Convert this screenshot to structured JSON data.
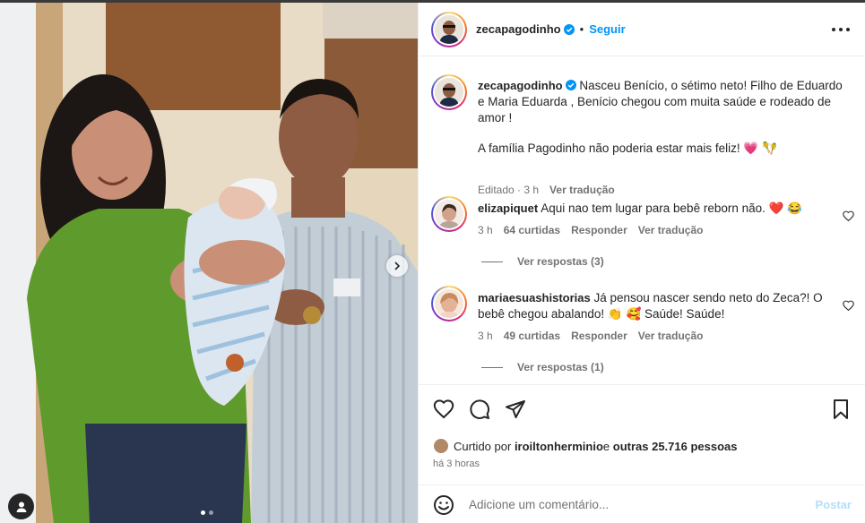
{
  "post": {
    "username": "zecapagodinho",
    "follow_label": "Seguir",
    "caption_line1": "Nasceu Benício, o sétimo neto! Filho de Eduardo",
    "caption_line2": "e Maria Eduarda , Benício chegou com muita saúde e rodeado de",
    "caption_line3": "amor !",
    "caption_line4": "A família Pagodinho não poderia estar mais feliz! 💗 🪇",
    "caption_edited": "Editado · 3 h",
    "caption_translate": "Ver tradução"
  },
  "comments": [
    {
      "username": "elizapiquet",
      "text": "Aqui nao tem lugar para bebê reborn não. ❤️ 😂",
      "time": "3 h",
      "likes": "64 curtidas",
      "reply": "Responder",
      "translate": "Ver tradução",
      "replies": "Ver respostas (3)"
    },
    {
      "username": "mariaesuashistorias",
      "text_line1": "Já pensou nascer sendo neto do Zeca?! O",
      "text_line2": "bebê chegou abalando! 👏 🥰 Saúde! Saúde!",
      "time": "3 h",
      "likes": "49 curtidas",
      "reply": "Responder",
      "translate": "Ver tradução",
      "replies": "Ver respostas (1)"
    }
  ],
  "likes_line": {
    "prefix": "Curtido por ",
    "user": "iroiltonherminio",
    "middle": " e ",
    "others": "outras 25.716 pessoas"
  },
  "timestamp": "há 3 horas",
  "add_comment": {
    "placeholder": "Adicione um comentário...",
    "submit": "Postar"
  },
  "carousel": {
    "total": 2,
    "active": 1
  },
  "colors": {
    "link": "#0095f6",
    "heart": "#ed4956",
    "muted": "#737373",
    "verified": "#0095f6"
  }
}
